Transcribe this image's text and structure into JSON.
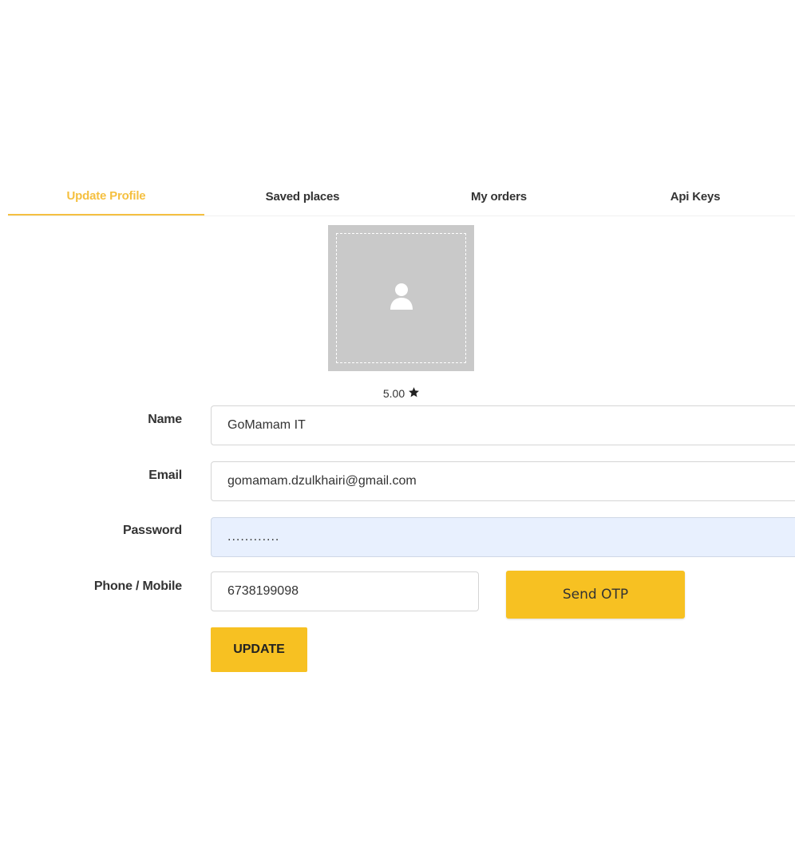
{
  "tabs": [
    {
      "label": "Update Profile",
      "active": true
    },
    {
      "label": "Saved places",
      "active": false
    },
    {
      "label": "My orders",
      "active": false
    },
    {
      "label": "Api Keys",
      "active": false
    }
  ],
  "profile": {
    "rating": "5.00",
    "avatar_icon": "user-icon",
    "rating_icon": "star-icon"
  },
  "form": {
    "name_label": "Name",
    "name_value": "GoMamam IT",
    "email_label": "Email",
    "email_value": "gomamam.dzulkhairi@gmail.com",
    "password_label": "Password",
    "password_value": "............",
    "phone_label": "Phone / Mobile",
    "phone_value": "6738199098",
    "send_otp_label": "Send OTP",
    "update_label": "UPDATE"
  },
  "colors": {
    "accent": "#f7c122",
    "active_tab": "#f5c040",
    "avatar_bg": "#c9c9c9",
    "autofill_bg": "#e8f0fe"
  }
}
